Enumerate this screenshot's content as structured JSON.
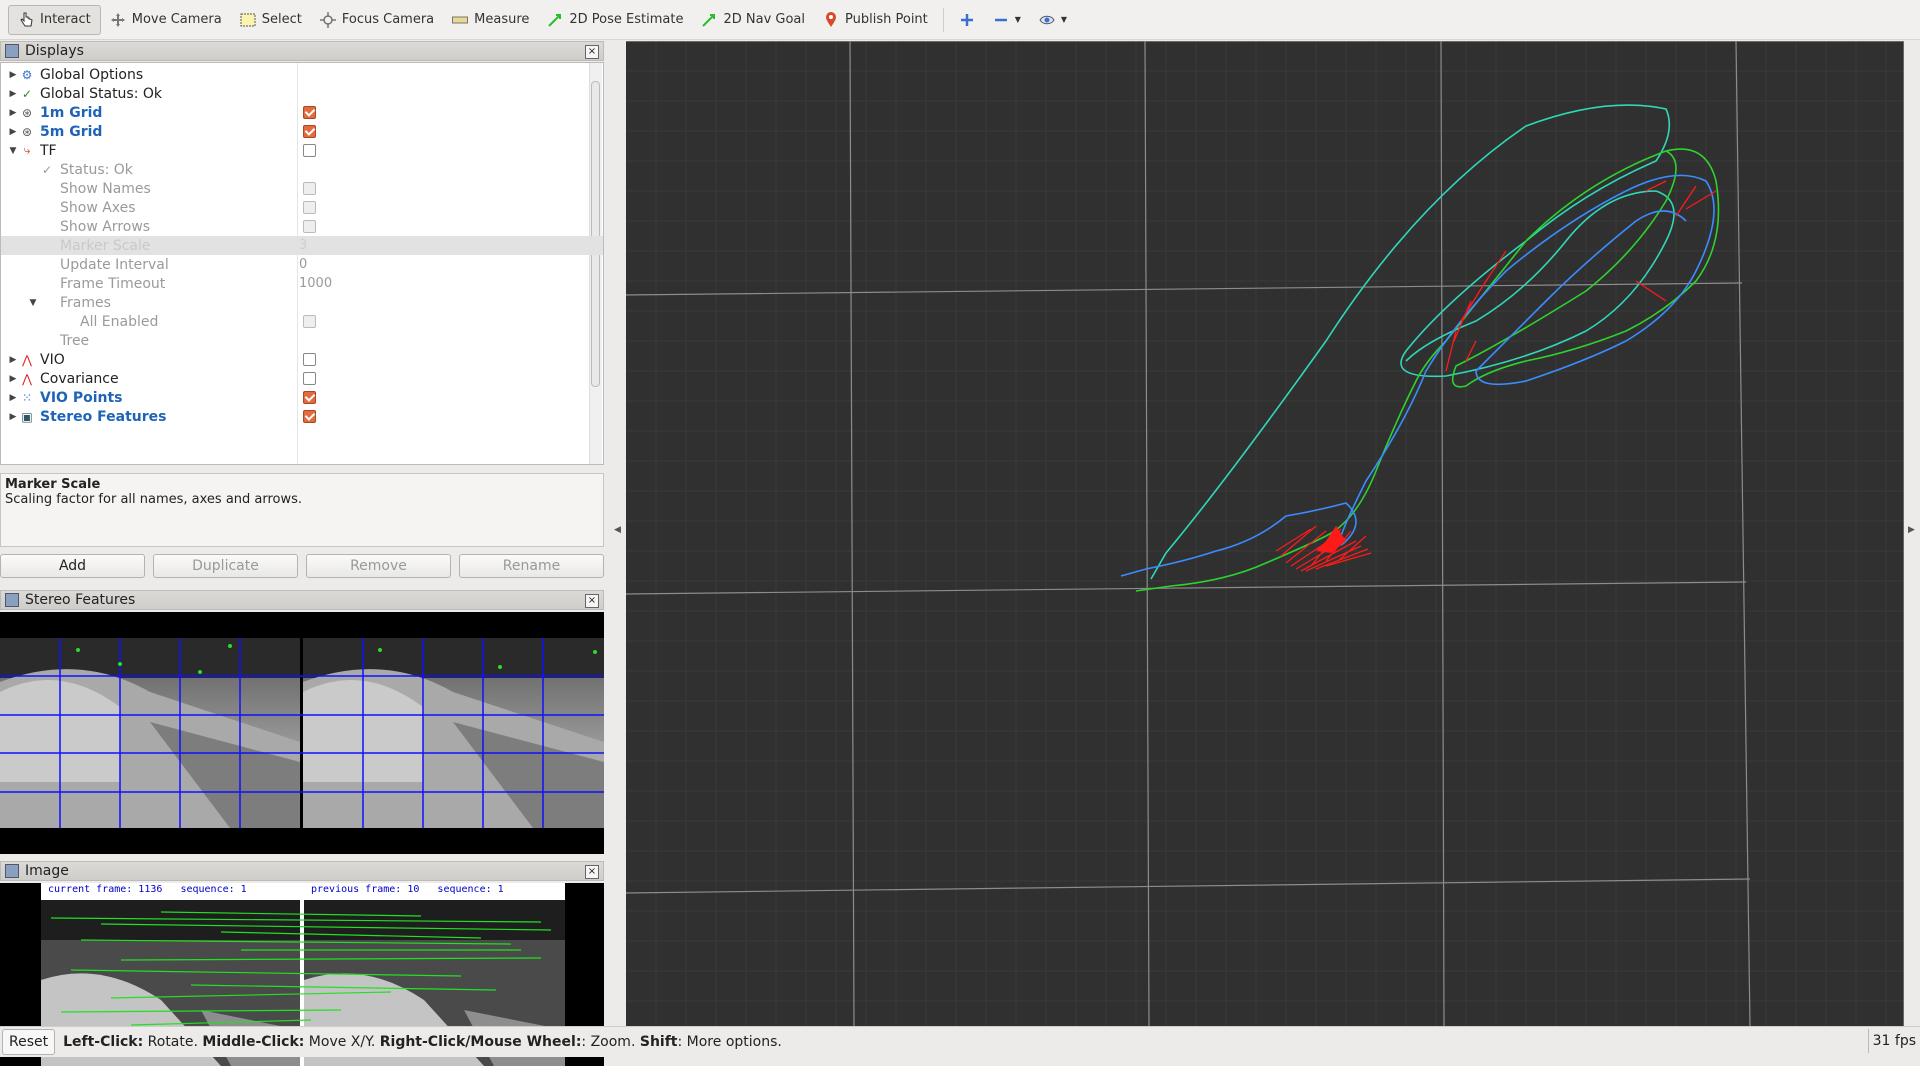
{
  "toolbar": {
    "tools": [
      {
        "label": "Interact",
        "icon": "hand-pointer-icon"
      },
      {
        "label": "Move Camera",
        "icon": "move-camera-icon"
      },
      {
        "label": "Select",
        "icon": "select-box-icon"
      },
      {
        "label": "Focus Camera",
        "icon": "crosshair-icon"
      },
      {
        "label": "Measure",
        "icon": "ruler-icon"
      },
      {
        "label": "2D Pose Estimate",
        "icon": "green-arrow-icon"
      },
      {
        "label": "2D Nav Goal",
        "icon": "green-arrow-icon"
      },
      {
        "label": "Publish Point",
        "icon": "map-pin-icon"
      }
    ]
  },
  "displays": {
    "title": "Displays",
    "items": [
      {
        "label": "Global Options",
        "style": "normal",
        "arrow": "▶"
      },
      {
        "label": "Global Status: Ok",
        "style": "normal",
        "arrow": "▶"
      },
      {
        "label": "1m Grid",
        "style": "blue",
        "arrow": "▶",
        "checked": true
      },
      {
        "label": "5m Grid",
        "style": "blue",
        "arrow": "▶",
        "checked": true
      },
      {
        "label": "TF",
        "style": "normal",
        "arrow": "▼",
        "checked": false
      },
      {
        "label": "Status: Ok",
        "style": "grey"
      },
      {
        "label": "Show Names",
        "style": "grey"
      },
      {
        "label": "Show Axes",
        "style": "grey"
      },
      {
        "label": "Show Arrows",
        "style": "grey"
      },
      {
        "label": "Marker Scale",
        "style": "grey",
        "value": "3"
      },
      {
        "label": "Update Interval",
        "style": "grey",
        "value": "0"
      },
      {
        "label": "Frame Timeout",
        "style": "grey",
        "value": "1000"
      },
      {
        "label": "Frames",
        "style": "grey",
        "arrow": "▼"
      },
      {
        "label": "All Enabled",
        "style": "grey"
      },
      {
        "label": "Tree",
        "style": "grey"
      },
      {
        "label": "VIO",
        "style": "normal",
        "arrow": "▶",
        "checked": false
      },
      {
        "label": "Covariance",
        "style": "normal",
        "arrow": "▶",
        "checked": false
      },
      {
        "label": "VIO Points",
        "style": "blue",
        "arrow": "▶",
        "checked": true
      },
      {
        "label": "Stereo Features",
        "style": "blue",
        "arrow": "▶",
        "checked": true
      }
    ]
  },
  "description": {
    "title": "Marker Scale",
    "text": "Scaling factor for all names, axes and arrows."
  },
  "buttons": {
    "add": "Add",
    "duplicate": "Duplicate",
    "remove": "Remove",
    "rename": "Rename"
  },
  "stereo_panel": {
    "title": "Stereo Features"
  },
  "image_panel": {
    "title": "Image",
    "current_frame": "current frame: 1136   sequence: 1",
    "previous_frame": "previous frame: 10   sequence: 1"
  },
  "status": {
    "reset": "Reset",
    "left_click": "Left-Click:",
    "left_click_desc": " Rotate. ",
    "middle_click": "Middle-Click:",
    "middle_click_desc": " Move X/Y. ",
    "right_click": "Right-Click/Mouse Wheel:",
    "right_click_desc": ": Zoom. ",
    "shift": "Shift",
    "shift_desc": ": More options.",
    "fps": "31 fps"
  },
  "colors": {
    "view_bg": "#303030",
    "grid": "#8a8a8a",
    "traj_green": "#2ed22e",
    "traj_blue": "#3b8cff",
    "traj_cyan": "#2fd8b8",
    "covariance_red": "#ff1a1a",
    "checkbox_on": "#e36b3d",
    "blue_label": "#1f63b7"
  }
}
